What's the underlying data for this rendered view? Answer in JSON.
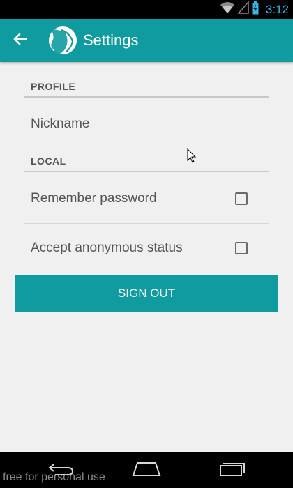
{
  "status_bar": {
    "time": "3:12"
  },
  "app_bar": {
    "title": "Settings"
  },
  "sections": {
    "profile": {
      "header": "PROFILE",
      "nickname_label": "Nickname"
    },
    "local": {
      "header": "LOCAL",
      "remember_password_label": "Remember password",
      "remember_password_checked": false,
      "accept_anonymous_label": "Accept anonymous status",
      "accept_anonymous_checked": false
    }
  },
  "sign_out_label": "SIGN OUT",
  "watermark": "free for personal use",
  "colors": {
    "accent": "#0f9ba0",
    "status_text": "#33b5e5"
  }
}
